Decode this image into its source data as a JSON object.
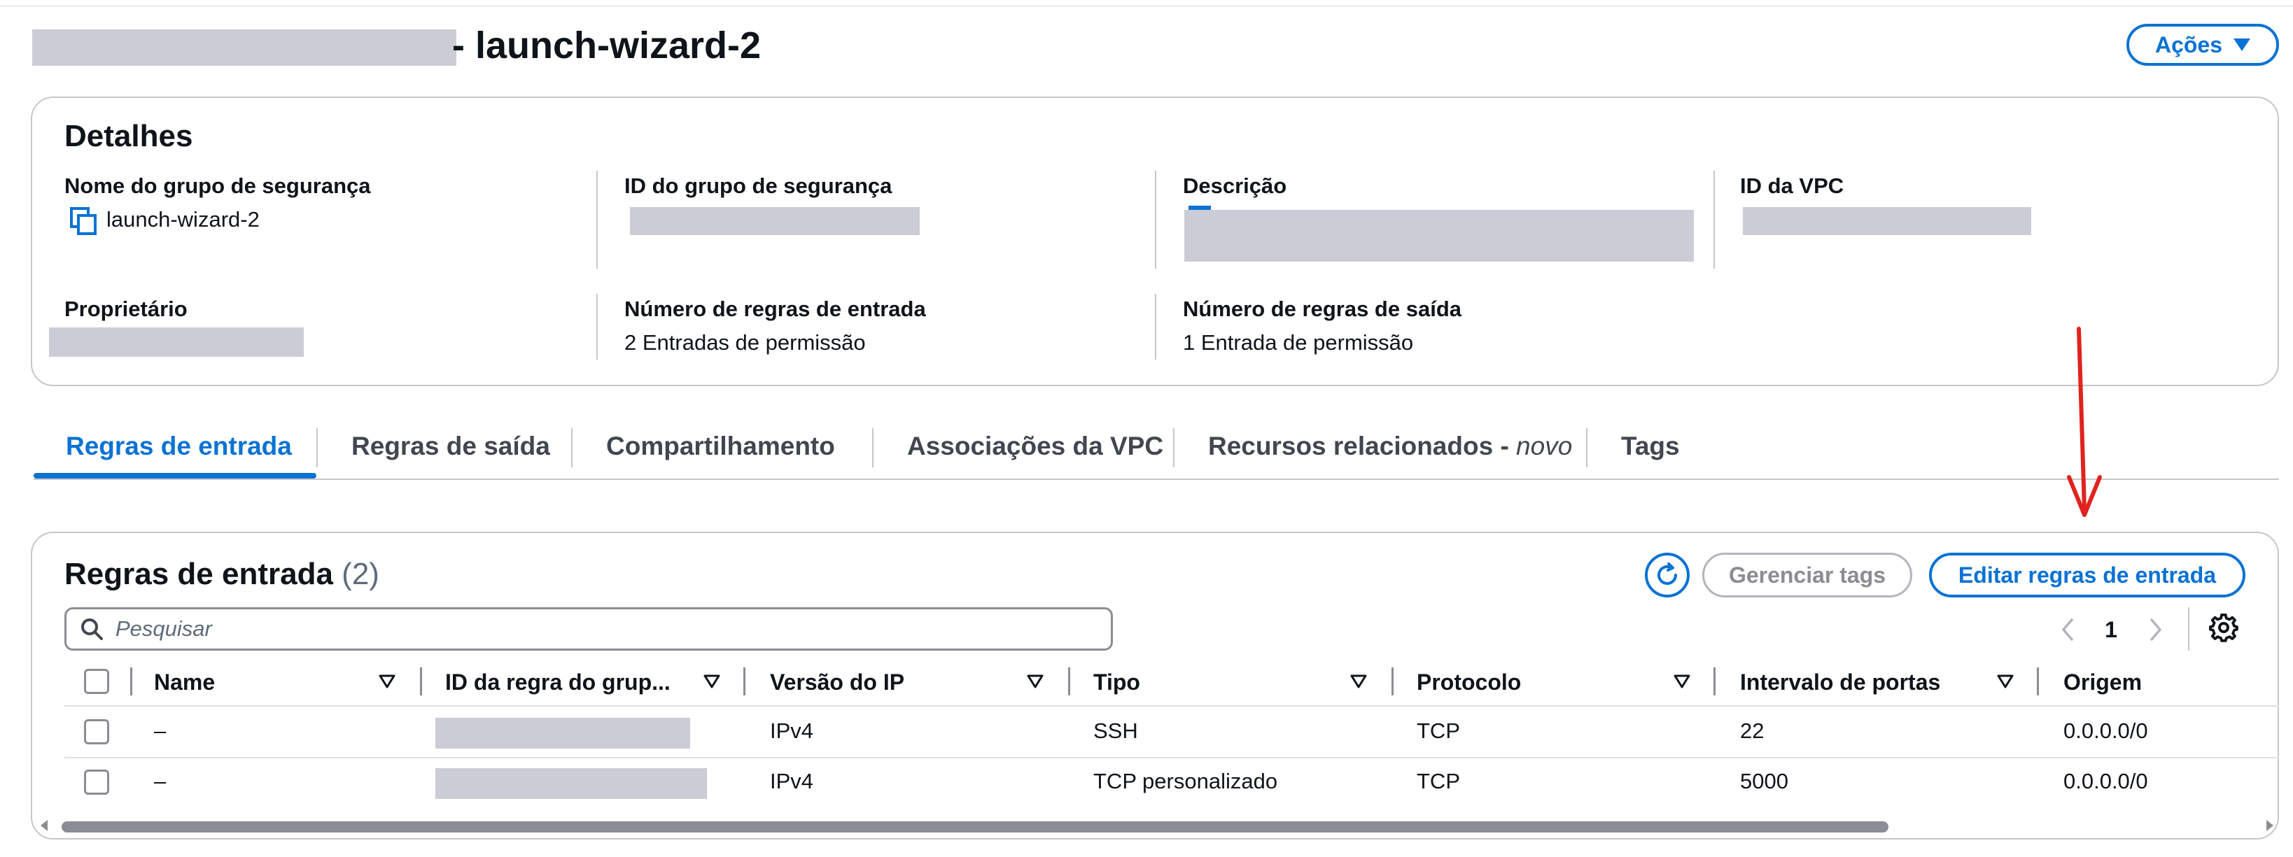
{
  "header": {
    "title_suffix": "- launch-wizard-2",
    "actions_label": "Ações"
  },
  "details": {
    "heading": "Detalhes",
    "fields": [
      {
        "label": "Nome do grupo de segurança",
        "value": "launch-wizard-2"
      },
      {
        "label": "ID do grupo de segurança",
        "value": ""
      },
      {
        "label": "Descrição",
        "value": ""
      },
      {
        "label": "ID da VPC",
        "value": ""
      },
      {
        "label": "Proprietário",
        "value": ""
      },
      {
        "label": "Número de regras de entrada",
        "value": "2 Entradas de permissão"
      },
      {
        "label": "Número de regras de saída",
        "value": "1 Entrada de permissão"
      }
    ]
  },
  "tabs": [
    {
      "label": "Regras de entrada",
      "active": true
    },
    {
      "label": "Regras de saída",
      "active": false
    },
    {
      "label": "Compartilhamento",
      "active": false
    },
    {
      "label": "Associações da VPC",
      "active": false
    },
    {
      "label": "Recursos relacionados - ",
      "suffix": "novo",
      "active": false
    },
    {
      "label": "Tags",
      "active": false
    }
  ],
  "rules": {
    "heading": "Regras de entrada",
    "count": "(2)",
    "manage_tags_label": "Gerenciar tags",
    "edit_label": "Editar regras de entrada",
    "search_placeholder": "Pesquisar",
    "page": "1",
    "columns": [
      "Name",
      "ID da regra do grup...",
      "Versão do IP",
      "Tipo",
      "Protocolo",
      "Intervalo de portas",
      "Origem"
    ],
    "rows": [
      {
        "name": "–",
        "rule_id": "",
        "ip_version": "IPv4",
        "type": "SSH",
        "protocol": "TCP",
        "port_range": "22",
        "source": "0.0.0.0/0"
      },
      {
        "name": "–",
        "rule_id": "",
        "ip_version": "IPv4",
        "type": "TCP personalizado",
        "protocol": "TCP",
        "port_range": "5000",
        "source": "0.0.0.0/0"
      }
    ]
  },
  "colors": {
    "accent": "#0972d3",
    "annotation": "#e0231e",
    "redaction": "#ccccd6",
    "border": "#c6c6cd"
  },
  "icons": {
    "copy": "copy-icon",
    "refresh": "refresh-icon",
    "search": "search-icon",
    "settings": "gear-icon",
    "sort": "sort-caret-icon"
  }
}
